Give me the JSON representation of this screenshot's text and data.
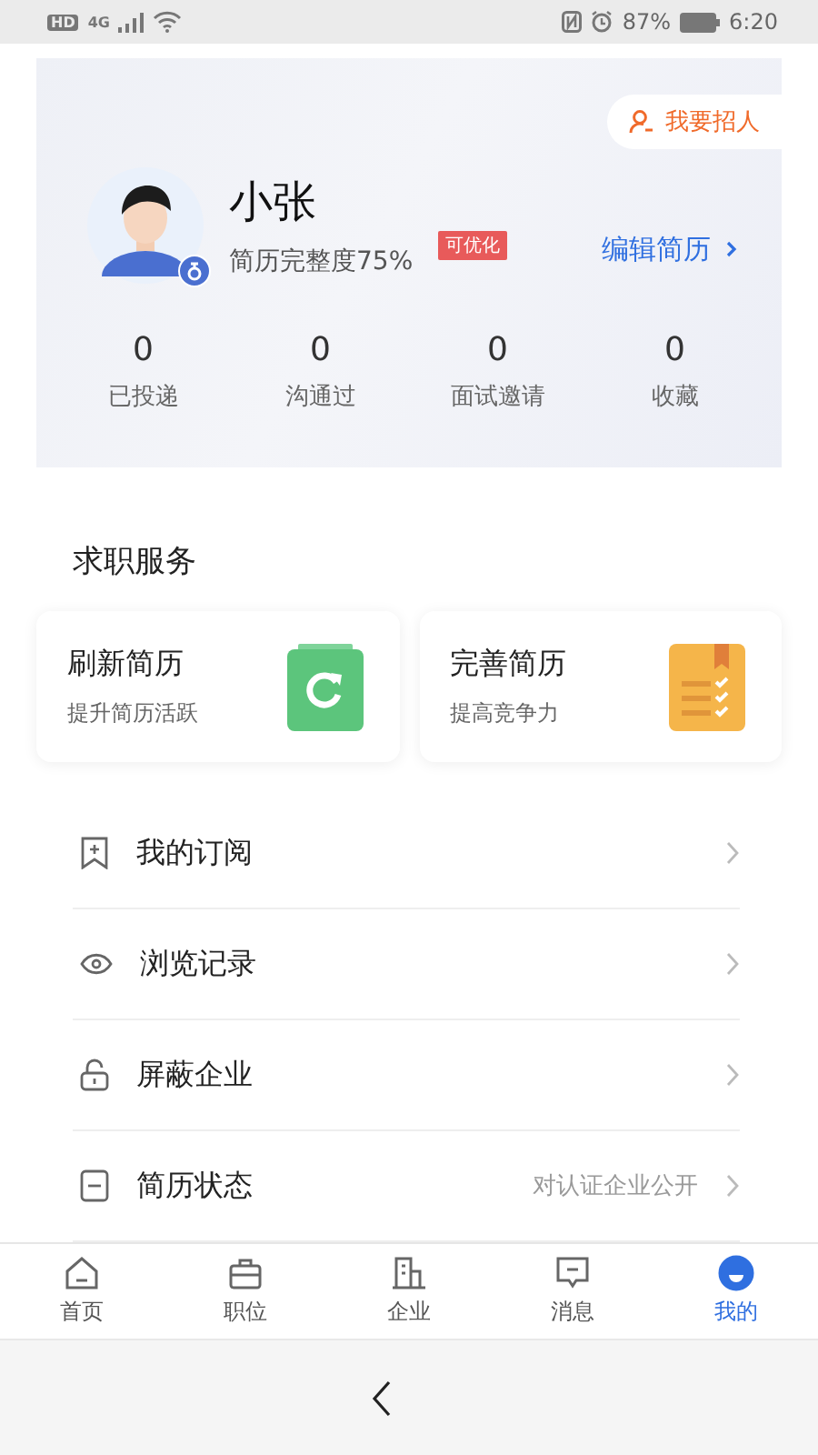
{
  "status_bar": {
    "network_badges": [
      "HD",
      "4G"
    ],
    "battery": "87%",
    "time": "6:20"
  },
  "profile": {
    "recruit_button": "我要招人",
    "name": "小张",
    "completeness": "简历完整度75%",
    "tag": "可优化",
    "edit_link": "编辑简历",
    "stats": [
      {
        "value": "0",
        "label": "已投递"
      },
      {
        "value": "0",
        "label": "沟通过"
      },
      {
        "value": "0",
        "label": "面试邀请"
      },
      {
        "value": "0",
        "label": "收藏"
      }
    ]
  },
  "services": {
    "title": "求职服务",
    "cards": [
      {
        "kind": "refresh",
        "title": "刷新简历",
        "subtitle": "提升简历活跃"
      },
      {
        "kind": "improve",
        "title": "完善简历",
        "subtitle": "提高竞争力"
      }
    ]
  },
  "menu": [
    {
      "kind": "subscribe",
      "label": "我的订阅"
    },
    {
      "kind": "history",
      "label": "浏览记录"
    },
    {
      "kind": "block",
      "label": "屏蔽企业"
    },
    {
      "kind": "status",
      "label": "简历状态",
      "value": "对认证企业公开"
    }
  ],
  "tabs": [
    {
      "kind": "home",
      "label": "首页",
      "selected": false
    },
    {
      "kind": "jobs",
      "label": "职位",
      "selected": false
    },
    {
      "kind": "company",
      "label": "企业",
      "selected": false
    },
    {
      "kind": "messages",
      "label": "消息",
      "selected": false
    },
    {
      "kind": "me",
      "label": "我的",
      "selected": true
    }
  ]
}
